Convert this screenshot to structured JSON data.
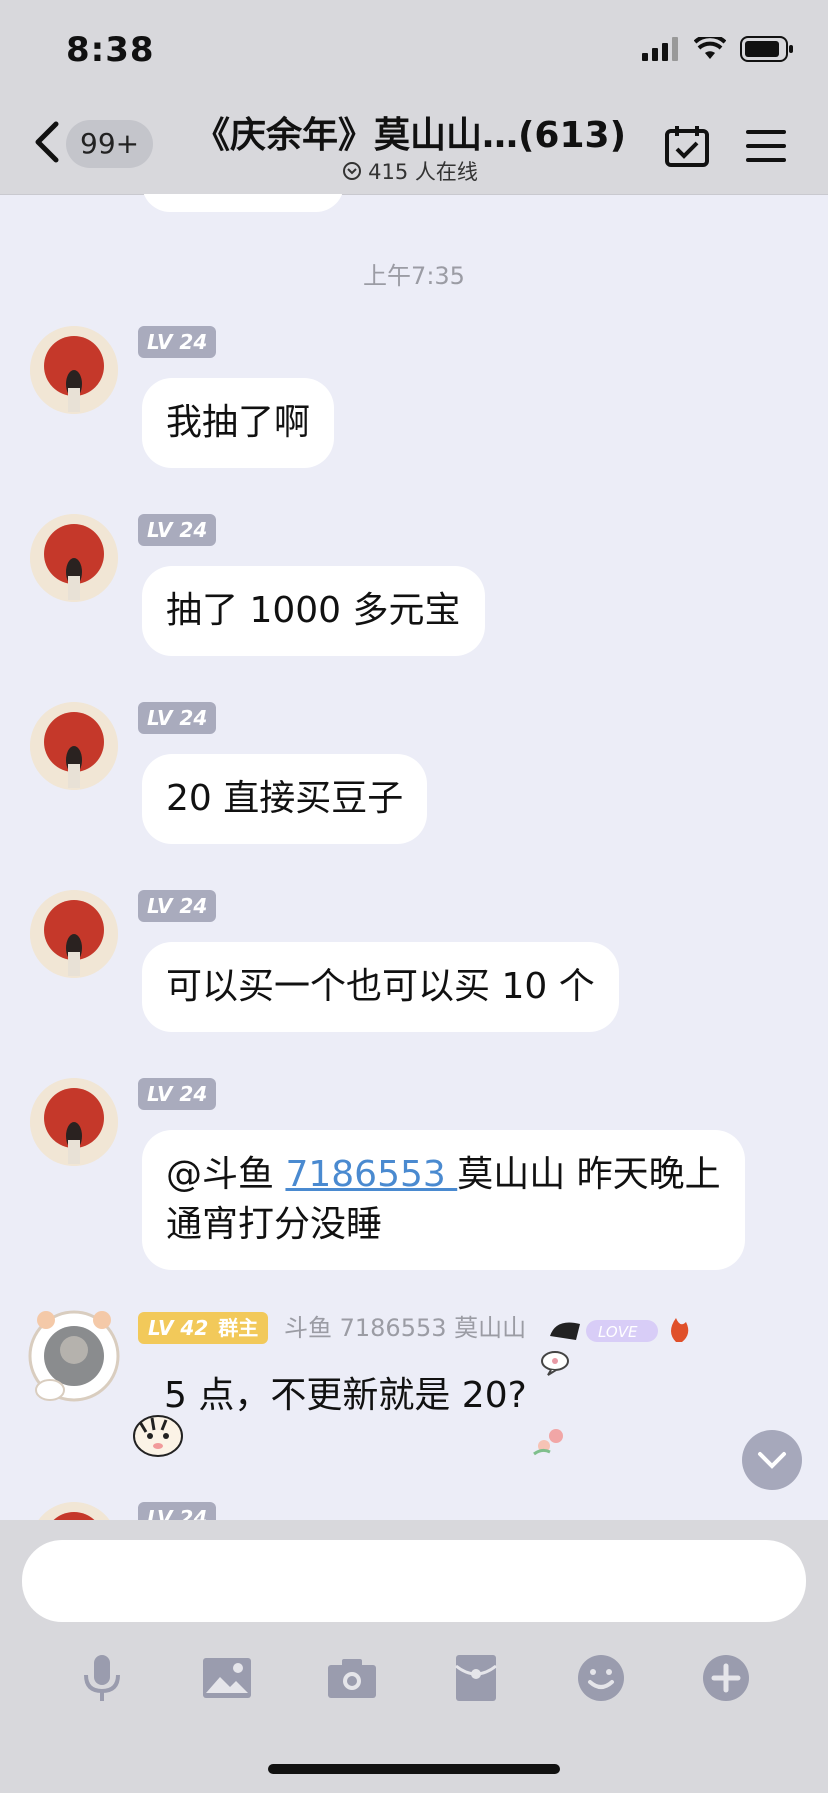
{
  "status_bar": {
    "time": "8:38"
  },
  "header": {
    "back_badge": "99+",
    "title": "《庆余年》莫山山…(613)",
    "online_count": "415 人在线"
  },
  "chat": {
    "timestamp": "上午7:35",
    "messages": [
      {
        "level": "LV 24",
        "text": "我抽了啊"
      },
      {
        "level": "LV 24",
        "text": "抽了 1000 多元宝"
      },
      {
        "level": "LV 24",
        "text": "20 直接买豆子"
      },
      {
        "level": "LV 24",
        "text": "可以买一个也可以买 10 个"
      },
      {
        "level": "LV 24",
        "mention": "@斗鱼 ",
        "link": "7186553 ",
        "text_after_link": "莫山山 昨天晚上",
        "text_line2": "通宵打分没睡"
      }
    ],
    "owner_message": {
      "level": "LV 42",
      "role": "群主",
      "sender": "斗鱼 7186553 莫山山",
      "text": "5 点，不更新就是 20?"
    },
    "partial_level": "LV 24"
  },
  "colors": {
    "accent_link": "#4a8ad0",
    "level_badge": "#a9abbd",
    "owner_badge": "#f2c95a"
  },
  "toolbar": {
    "icons": [
      "microphone-icon",
      "image-icon",
      "camera-icon",
      "red-packet-icon",
      "emoji-icon",
      "plus-icon"
    ]
  }
}
